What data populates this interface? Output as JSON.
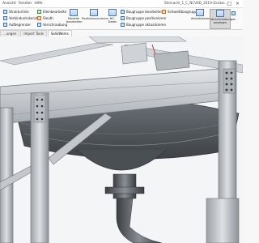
{
  "menu": [
    "Ansicht",
    "Fenster",
    "Hilfe"
  ],
  "document_title": "Steinachl_1_C_NCVAD_2019-Zeichn...",
  "window_controls": {
    "minimize": "–",
    "maximize": "□",
    "close": "×"
  },
  "ribbon": {
    "group_left": [
      "Strukturlinie",
      "Verbindunkskonst.",
      "Aufbegrenzer"
    ],
    "group_mid": [
      "Kleinbearbeite",
      "Sleuth",
      "Verschraubung"
    ],
    "big_buttons": [
      "Modelle bearbeiten",
      "Positionsnummern",
      "NC-Daten"
    ],
    "group_right": [
      "Baugruppe bearbeiten",
      "Baugruppe positionieren",
      "Baugruppe aktualisieren"
    ],
    "group_far": [
      "Schweißbaugruppen"
    ],
    "big_right": [
      "Aktualisieren",
      "Verschraubungen anzeigen"
    ]
  },
  "tabs": [
    "...ungen",
    "Import Tools",
    "SolidWorks"
  ],
  "active_tab": 2,
  "colors": {
    "steel": "#c9cdd2",
    "steel_dark": "#7d8288",
    "accent_blue": "#3a6fb0",
    "selection": "#d7d7d7"
  }
}
